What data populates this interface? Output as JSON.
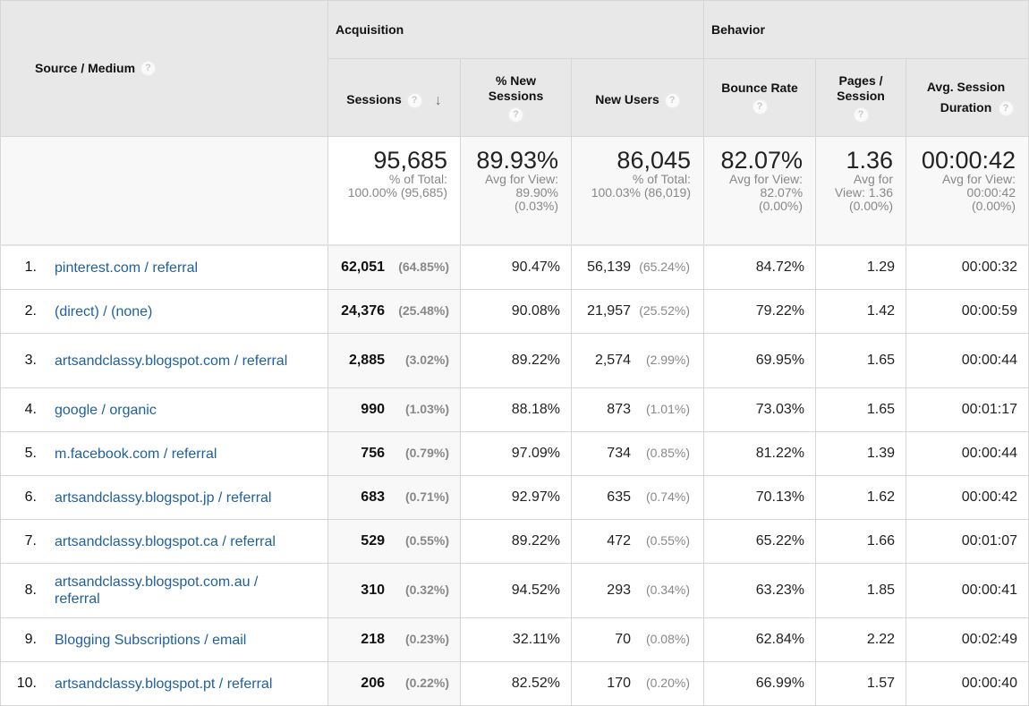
{
  "header": {
    "dimension": "Source / Medium",
    "groups": {
      "acquisition": "Acquisition",
      "behavior": "Behavior"
    },
    "columns": {
      "sessions": "Sessions",
      "pct_new_sessions": "% New Sessions",
      "new_users": "New Users",
      "bounce_rate": "Bounce Rate",
      "pages_session": "Pages / Session",
      "avg_duration": "Avg. Session Duration"
    },
    "help_glyph": "?",
    "sort_glyph": "↓"
  },
  "summary": {
    "sessions": {
      "value": "95,685",
      "line1": "% of Total:",
      "line2": "100.00% (95,685)"
    },
    "pct_new_sessions": {
      "value": "89.93%",
      "line1": "Avg for View:",
      "line2": "89.90%",
      "line3": "(0.03%)"
    },
    "new_users": {
      "value": "86,045",
      "line1": "% of Total:",
      "line2": "100.03% (86,019)"
    },
    "bounce_rate": {
      "value": "82.07%",
      "line1": "Avg for View:",
      "line2": "82.07%",
      "line3": "(0.00%)"
    },
    "pages_session": {
      "value": "1.36",
      "line1": "Avg for",
      "line2": "View: 1.36",
      "line3": "(0.00%)"
    },
    "avg_duration": {
      "value": "00:00:42",
      "line1": "Avg for View:",
      "line2": "00:00:42",
      "line3": "(0.00%)"
    }
  },
  "rows": [
    {
      "index": "1.",
      "source": "pinterest.com / referral",
      "sessions": "62,051",
      "sessions_pct": "(64.85%)",
      "pct_new": "90.47%",
      "new_users": "56,139",
      "new_users_pct": "(65.24%)",
      "bounce": "84.72%",
      "pages": "1.29",
      "duration": "00:00:32"
    },
    {
      "index": "2.",
      "source": "(direct) / (none)",
      "sessions": "24,376",
      "sessions_pct": "(25.48%)",
      "pct_new": "90.08%",
      "new_users": "21,957",
      "new_users_pct": "(25.52%)",
      "bounce": "79.22%",
      "pages": "1.42",
      "duration": "00:00:59"
    },
    {
      "index": "3.",
      "source": "artsandclassy.blogspot.com / referral",
      "sessions": "2,885",
      "sessions_pct": "(3.02%)",
      "pct_new": "89.22%",
      "new_users": "2,574",
      "new_users_pct": "(2.99%)",
      "bounce": "69.95%",
      "pages": "1.65",
      "duration": "00:00:44"
    },
    {
      "index": "4.",
      "source": "google / organic",
      "sessions": "990",
      "sessions_pct": "(1.03%)",
      "pct_new": "88.18%",
      "new_users": "873",
      "new_users_pct": "(1.01%)",
      "bounce": "73.03%",
      "pages": "1.65",
      "duration": "00:01:17"
    },
    {
      "index": "5.",
      "source": "m.facebook.com / referral",
      "sessions": "756",
      "sessions_pct": "(0.79%)",
      "pct_new": "97.09%",
      "new_users": "734",
      "new_users_pct": "(0.85%)",
      "bounce": "81.22%",
      "pages": "1.39",
      "duration": "00:00:44"
    },
    {
      "index": "6.",
      "source": "artsandclassy.blogspot.jp / referral",
      "sessions": "683",
      "sessions_pct": "(0.71%)",
      "pct_new": "92.97%",
      "new_users": "635",
      "new_users_pct": "(0.74%)",
      "bounce": "70.13%",
      "pages": "1.62",
      "duration": "00:00:42"
    },
    {
      "index": "7.",
      "source": "artsandclassy.blogspot.ca / referral",
      "sessions": "529",
      "sessions_pct": "(0.55%)",
      "pct_new": "89.22%",
      "new_users": "472",
      "new_users_pct": "(0.55%)",
      "bounce": "65.22%",
      "pages": "1.66",
      "duration": "00:01:07"
    },
    {
      "index": "8.",
      "source": "artsandclassy.blogspot.com.au / referral",
      "sessions": "310",
      "sessions_pct": "(0.32%)",
      "pct_new": "94.52%",
      "new_users": "293",
      "new_users_pct": "(0.34%)",
      "bounce": "63.23%",
      "pages": "1.85",
      "duration": "00:00:41"
    },
    {
      "index": "9.",
      "source": "Blogging Subscriptions / email",
      "sessions": "218",
      "sessions_pct": "(0.23%)",
      "pct_new": "32.11%",
      "new_users": "70",
      "new_users_pct": "(0.08%)",
      "bounce": "62.84%",
      "pages": "2.22",
      "duration": "00:02:49"
    },
    {
      "index": "10.",
      "source": "artsandclassy.blogspot.pt / referral",
      "sessions": "206",
      "sessions_pct": "(0.22%)",
      "pct_new": "82.52%",
      "new_users": "170",
      "new_users_pct": "(0.20%)",
      "bounce": "66.99%",
      "pages": "1.57",
      "duration": "00:00:40"
    }
  ]
}
